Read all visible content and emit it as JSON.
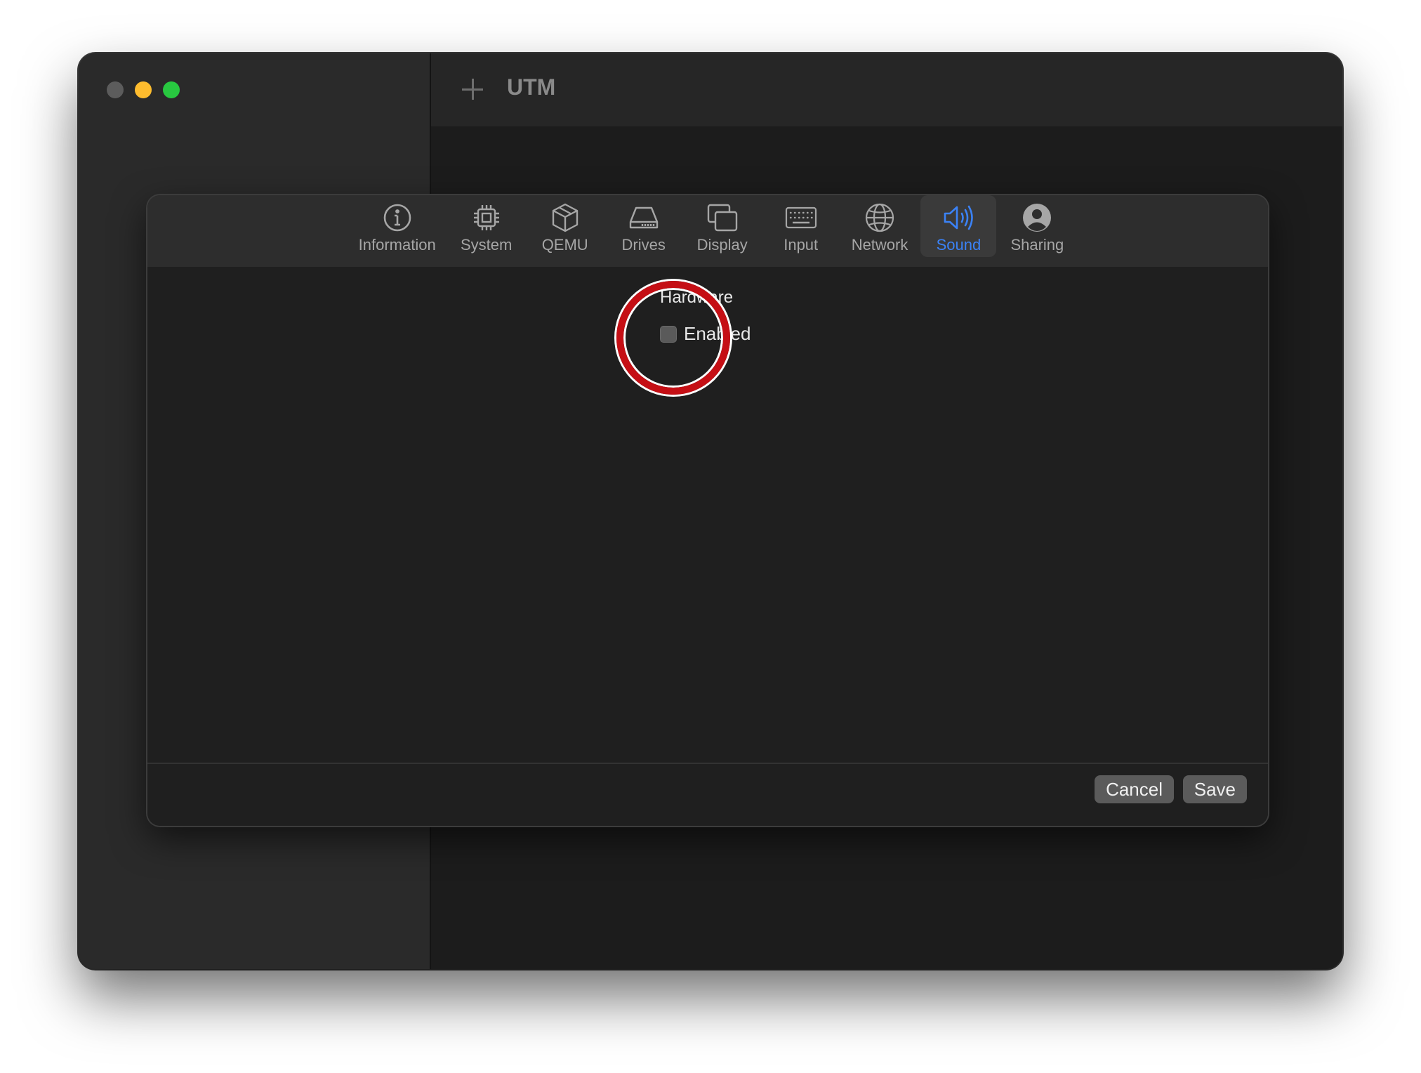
{
  "app": {
    "title": "UTM"
  },
  "tabs": [
    {
      "label": "Information",
      "icon": "info-icon",
      "active": false
    },
    {
      "label": "System",
      "icon": "cpu-icon",
      "active": false
    },
    {
      "label": "QEMU",
      "icon": "cube-icon",
      "active": false
    },
    {
      "label": "Drives",
      "icon": "drive-icon",
      "active": false
    },
    {
      "label": "Display",
      "icon": "display-icon",
      "active": false
    },
    {
      "label": "Input",
      "icon": "keyboard-icon",
      "active": false
    },
    {
      "label": "Network",
      "icon": "globe-icon",
      "active": false
    },
    {
      "label": "Sound",
      "icon": "speaker-icon",
      "active": true
    },
    {
      "label": "Sharing",
      "icon": "person-icon",
      "active": false
    }
  ],
  "sound": {
    "section_title": "Hardware",
    "enabled_label": "Enabled",
    "enabled_checked": false
  },
  "footer": {
    "cancel_label": "Cancel",
    "save_label": "Save"
  },
  "colors": {
    "accent": "#3b82f6",
    "highlight_ring": "#c50f15",
    "traffic_close": "#5c5c5c",
    "traffic_minimize": "#febc2e",
    "traffic_maximize": "#28c840"
  }
}
